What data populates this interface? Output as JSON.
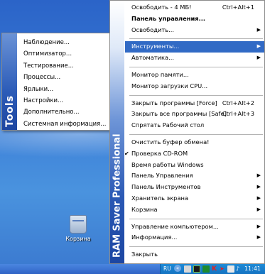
{
  "tools_menu": {
    "strip_label": "Tools",
    "items": [
      {
        "label": "Наблюдение..."
      },
      {
        "label": "Оптимизатор..."
      },
      {
        "label": "Тестирование..."
      },
      {
        "label": "Процессы..."
      },
      {
        "label": "Ярлыки..."
      },
      {
        "label": "Настройки..."
      },
      {
        "label": "Дополнительно..."
      },
      {
        "label": "Системная информация..."
      }
    ]
  },
  "main_menu": {
    "strip_label": "RAM Saver Professional",
    "items": {
      "free_4mb": {
        "label": "Освободить - 4 МБ!",
        "shortcut": "Ctrl+Alt+1"
      },
      "control_panel": {
        "label": "Панель управления..."
      },
      "free": {
        "label": "Освободить..."
      },
      "tools": {
        "label": "Инструменты..."
      },
      "autostart": {
        "label": "Автоматика..."
      },
      "memory_monitor": {
        "label": "Монитор памяти..."
      },
      "cpu_monitor": {
        "label": "Монитор загрузки CPU..."
      },
      "close_force": {
        "label": "Закрыть программы [Force]",
        "shortcut": "Ctrl+Alt+2"
      },
      "close_all_safe": {
        "label": "Закрыть все программы [Safe]",
        "shortcut": "Ctrl+Alt+3"
      },
      "hide_desktop": {
        "label": "Спрятать Рабочий стол"
      },
      "clear_clipboard": {
        "label": "Очистить буфер обмена!"
      },
      "check_cdrom": {
        "label": "Проверка CD-ROM"
      },
      "windows_uptime": {
        "label": "Время работы Windows"
      },
      "control_panel_sub": {
        "label": "Панель Управления"
      },
      "tools_panel": {
        "label": "Панель Инструментов"
      },
      "screensaver": {
        "label": "Хранитель экрана"
      },
      "recycle_bin": {
        "label": "Корзина"
      },
      "computer_management": {
        "label": "Управление компьютером..."
      },
      "information": {
        "label": "Информация..."
      },
      "close": {
        "label": "Закрыть"
      }
    }
  },
  "desktop": {
    "recycle_bin_label": "Корзина"
  },
  "taskbar": {
    "language": "RU",
    "clock": "11:41"
  },
  "colors": {
    "highlight": "#316ac5",
    "desktop": "#3c7fd8",
    "taskbar": "#2f63c5"
  }
}
